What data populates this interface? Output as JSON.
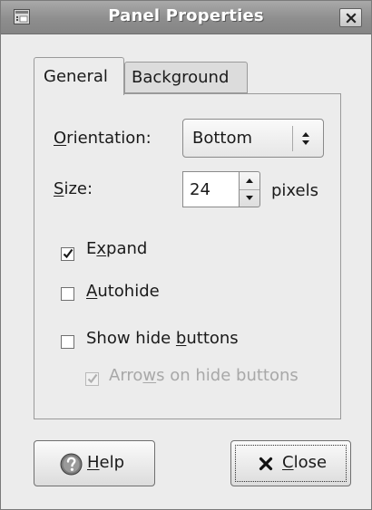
{
  "window": {
    "title": "Panel Properties"
  },
  "tabs": [
    {
      "label": "General",
      "active": true
    },
    {
      "label": "Background",
      "active": false
    }
  ],
  "general": {
    "orientation": {
      "label_mnemonic": "O",
      "label_rest": "rientation:",
      "value": "Bottom"
    },
    "size": {
      "label_mnemonic": "S",
      "label_rest": "ize:",
      "value": "24",
      "unit": "pixels"
    },
    "options": [
      {
        "pre": "E",
        "mnemonic": "x",
        "post": "pand",
        "checked": true,
        "enabled": true
      },
      {
        "pre": "",
        "mnemonic": "A",
        "post": "utohide",
        "checked": false,
        "enabled": true
      },
      {
        "pre": "Show hide ",
        "mnemonic": "b",
        "post": "uttons",
        "checked": false,
        "enabled": true
      },
      {
        "pre": "Arro",
        "mnemonic": "w",
        "post": "s on hide buttons",
        "checked": true,
        "enabled": false
      }
    ]
  },
  "buttons": {
    "help": {
      "mnemonic": "H",
      "rest": "elp"
    },
    "close": {
      "mnemonic": "C",
      "rest": "lose"
    }
  },
  "icons": {
    "window": "panel-icon",
    "close_window": "close-icon",
    "help": "help-icon",
    "close_button": "close-x-icon"
  },
  "colors": {
    "titlebar": "#8e8e8e",
    "window_bg": "#ececec",
    "disabled_text": "#a8a8a8"
  }
}
